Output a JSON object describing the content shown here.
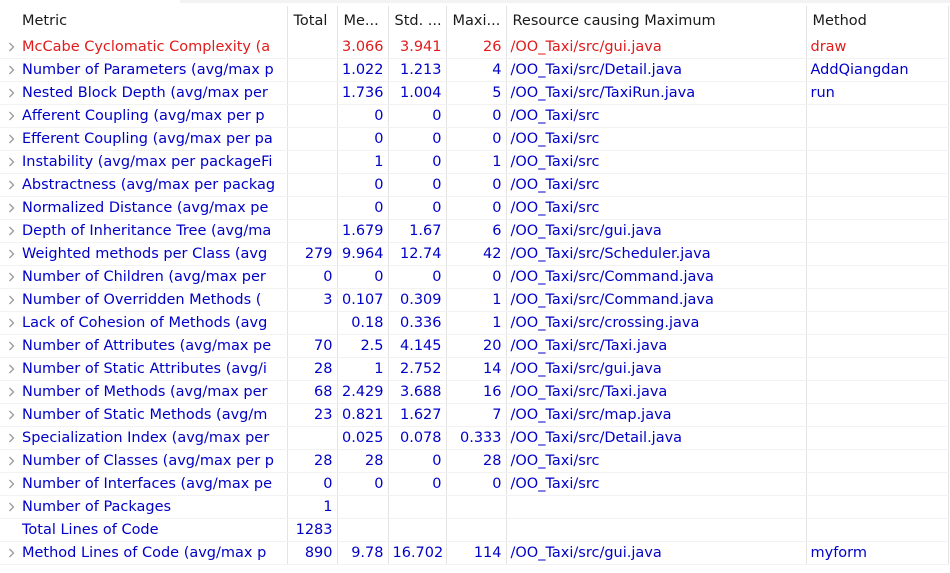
{
  "table": {
    "columns": {
      "metric": "Metric",
      "total": "Total",
      "mean": "Me...",
      "std": "Std. ...",
      "max": "Maxi...",
      "resource": "Resource causing Maximum",
      "method": "Method"
    },
    "rows": [
      {
        "metric": "McCabe Cyclomatic Complexity (a",
        "total": "",
        "mean": "3.066",
        "std": "3.941",
        "max": "26",
        "resource": "/OO_Taxi/src/gui.java",
        "method": "draw",
        "status": "error"
      },
      {
        "metric": "Number of Parameters (avg/max p",
        "total": "",
        "mean": "1.022",
        "std": "1.213",
        "max": "4",
        "resource": "/OO_Taxi/src/Detail.java",
        "method": "AddQiangdan"
      },
      {
        "metric": "Nested Block Depth (avg/max per",
        "total": "",
        "mean": "1.736",
        "std": "1.004",
        "max": "5",
        "resource": "/OO_Taxi/src/TaxiRun.java",
        "method": "run"
      },
      {
        "metric": "Afferent Coupling (avg/max per p",
        "total": "",
        "mean": "0",
        "std": "0",
        "max": "0",
        "resource": "/OO_Taxi/src",
        "method": ""
      },
      {
        "metric": "Efferent Coupling (avg/max per pa",
        "total": "",
        "mean": "0",
        "std": "0",
        "max": "0",
        "resource": "/OO_Taxi/src",
        "method": ""
      },
      {
        "metric": "Instability (avg/max per packageFi",
        "total": "",
        "mean": "1",
        "std": "0",
        "max": "1",
        "resource": "/OO_Taxi/src",
        "method": ""
      },
      {
        "metric": "Abstractness (avg/max per packag",
        "total": "",
        "mean": "0",
        "std": "0",
        "max": "0",
        "resource": "/OO_Taxi/src",
        "method": ""
      },
      {
        "metric": "Normalized Distance (avg/max pe",
        "total": "",
        "mean": "0",
        "std": "0",
        "max": "0",
        "resource": "/OO_Taxi/src",
        "method": ""
      },
      {
        "metric": "Depth of Inheritance Tree (avg/ma",
        "total": "",
        "mean": "1.679",
        "std": "1.67",
        "max": "6",
        "resource": "/OO_Taxi/src/gui.java",
        "method": ""
      },
      {
        "metric": "Weighted methods per Class (avg",
        "total": "279",
        "mean": "9.964",
        "std": "12.74",
        "max": "42",
        "resource": "/OO_Taxi/src/Scheduler.java",
        "method": ""
      },
      {
        "metric": "Number of Children (avg/max per",
        "total": "0",
        "mean": "0",
        "std": "0",
        "max": "0",
        "resource": "/OO_Taxi/src/Command.java",
        "method": ""
      },
      {
        "metric": "Number of Overridden Methods (",
        "total": "3",
        "mean": "0.107",
        "std": "0.309",
        "max": "1",
        "resource": "/OO_Taxi/src/Command.java",
        "method": ""
      },
      {
        "metric": "Lack of Cohesion of Methods (avg",
        "total": "",
        "mean": "0.18",
        "std": "0.336",
        "max": "1",
        "resource": "/OO_Taxi/src/crossing.java",
        "method": ""
      },
      {
        "metric": "Number of Attributes (avg/max pe",
        "total": "70",
        "mean": "2.5",
        "std": "4.145",
        "max": "20",
        "resource": "/OO_Taxi/src/Taxi.java",
        "method": ""
      },
      {
        "metric": "Number of Static Attributes (avg/i",
        "total": "28",
        "mean": "1",
        "std": "2.752",
        "max": "14",
        "resource": "/OO_Taxi/src/gui.java",
        "method": ""
      },
      {
        "metric": "Number of Methods (avg/max per",
        "total": "68",
        "mean": "2.429",
        "std": "3.688",
        "max": "16",
        "resource": "/OO_Taxi/src/Taxi.java",
        "method": ""
      },
      {
        "metric": "Number of Static Methods (avg/m",
        "total": "23",
        "mean": "0.821",
        "std": "1.627",
        "max": "7",
        "resource": "/OO_Taxi/src/map.java",
        "method": ""
      },
      {
        "metric": "Specialization Index (avg/max per",
        "total": "",
        "mean": "0.025",
        "std": "0.078",
        "max": "0.333",
        "resource": "/OO_Taxi/src/Detail.java",
        "method": ""
      },
      {
        "metric": "Number of Classes (avg/max per p",
        "total": "28",
        "mean": "28",
        "std": "0",
        "max": "28",
        "resource": "/OO_Taxi/src",
        "method": ""
      },
      {
        "metric": "Number of Interfaces (avg/max pe",
        "total": "0",
        "mean": "0",
        "std": "0",
        "max": "0",
        "resource": "/OO_Taxi/src",
        "method": ""
      },
      {
        "metric": "Number of Packages",
        "total": "1",
        "mean": "",
        "std": "",
        "max": "",
        "resource": "",
        "method": ""
      },
      {
        "metric": "Total Lines of Code",
        "total": "1283",
        "mean": "",
        "std": "",
        "max": "",
        "resource": "",
        "method": "",
        "expandable": false
      },
      {
        "metric": "Method Lines of Code (avg/max p",
        "total": "890",
        "mean": "9.78",
        "std": "16.702",
        "max": "114",
        "resource": "/OO_Taxi/src/gui.java",
        "method": "myform"
      }
    ]
  },
  "colors": {
    "normal_text": "#0000c8",
    "error_text": "#e01b1b",
    "header_text": "#1a1a1a",
    "grid_line": "#e4e4e4"
  },
  "icons": {
    "expand": "chevron-right-icon"
  }
}
